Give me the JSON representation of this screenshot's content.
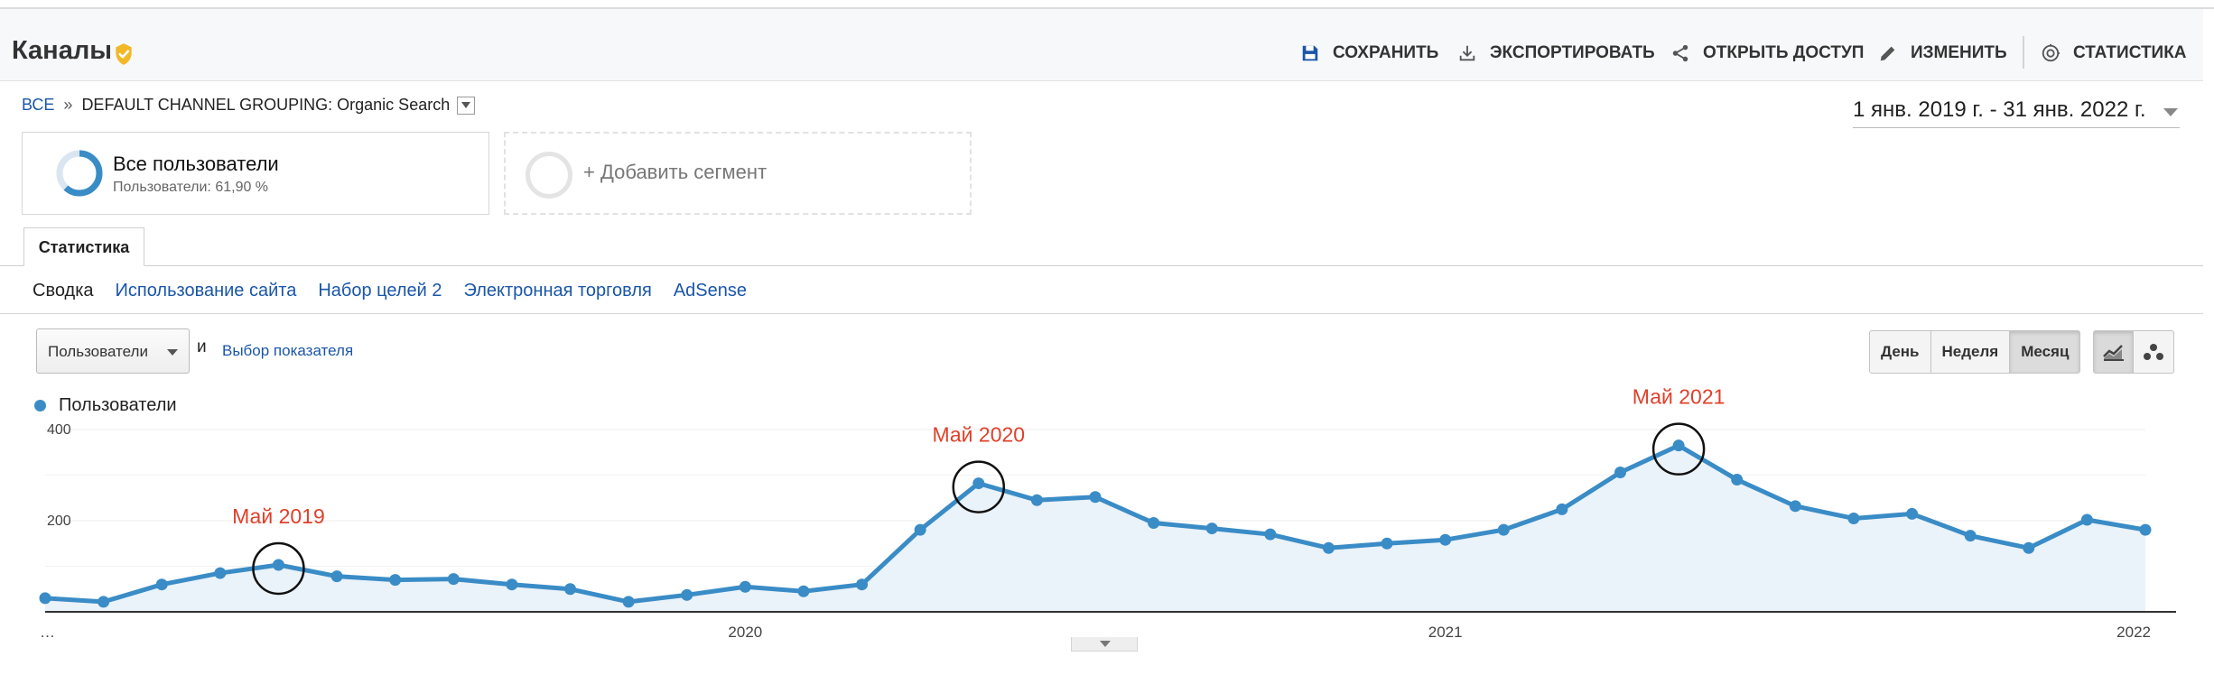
{
  "header": {
    "title": "Каналы",
    "toolbar": {
      "save": "СОХРАНИТЬ",
      "export": "ЭКСПОРТИРОВАТЬ",
      "share": "ОТКРЫТЬ ДОСТУП",
      "edit": "ИЗМЕНИТЬ",
      "insights": "СТАТИСТИКА"
    }
  },
  "breadcrumb": {
    "root": "ВСЕ",
    "separator": "»",
    "current": "DEFAULT CHANNEL GROUPING: Organic Search"
  },
  "date_range": "1 янв. 2019 г. - 31 янв. 2022 г.",
  "segments": {
    "active": {
      "title": "Все пользователи",
      "subtitle": "Пользователи: 61,90 %",
      "share": 0.619
    },
    "add_label": "+ Добавить сегмент"
  },
  "tabs": {
    "active": "Статистика"
  },
  "subnav": [
    "Сводка",
    "Использование сайта",
    "Набор целей 2",
    "Электронная торговля",
    "AdSense"
  ],
  "controls": {
    "metric_select": "Пользователи",
    "and_label": "и",
    "choose_metric": "Выбор показателя",
    "periods": [
      "День",
      "Неделя",
      "Месяц"
    ],
    "active_period": "Месяц"
  },
  "legend": {
    "series_name": "Пользователи"
  },
  "colors": {
    "line": "#3a8cc6",
    "fill": "#eaf2fa",
    "annotation": "#e0402a",
    "link": "#1a56a8",
    "verified": "#f2b826"
  },
  "chart_data": {
    "type": "area",
    "series_name": "Пользователи",
    "x": [
      "2019-01",
      "2019-02",
      "2019-03",
      "2019-04",
      "2019-05",
      "2019-06",
      "2019-07",
      "2019-08",
      "2019-09",
      "2019-10",
      "2019-11",
      "2019-12",
      "2020-01",
      "2020-02",
      "2020-03",
      "2020-04",
      "2020-05",
      "2020-06",
      "2020-07",
      "2020-08",
      "2020-09",
      "2020-10",
      "2020-11",
      "2020-12",
      "2021-01",
      "2021-02",
      "2021-03",
      "2021-04",
      "2021-05",
      "2021-06",
      "2021-07",
      "2021-08",
      "2021-09",
      "2021-10",
      "2021-11",
      "2021-12",
      "2022-01"
    ],
    "values": [
      30,
      22,
      60,
      85,
      103,
      78,
      70,
      72,
      60,
      50,
      22,
      37,
      55,
      45,
      60,
      180,
      282,
      245,
      252,
      195,
      183,
      170,
      140,
      150,
      158,
      180,
      225,
      306,
      365,
      290,
      232,
      205,
      215,
      167,
      140,
      202,
      180
    ],
    "x_tick_labels": [
      "…",
      "2020",
      "2021",
      "2022"
    ],
    "y_ticks": [
      200,
      400
    ],
    "ylim": [
      0,
      400
    ],
    "annotations": [
      {
        "label": "Май 2019",
        "x": "2019-05",
        "value": 103
      },
      {
        "label": "Май 2020",
        "x": "2020-05",
        "value": 282
      },
      {
        "label": "Май 2021",
        "x": "2021-05",
        "value": 365
      }
    ]
  }
}
